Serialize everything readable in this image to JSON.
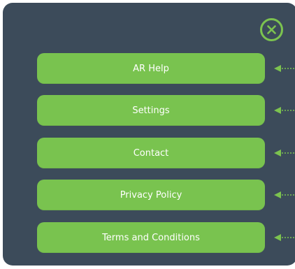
{
  "close": {
    "icon": "close-icon"
  },
  "menu": {
    "items": [
      {
        "label": "AR Help"
      },
      {
        "label": "Settings"
      },
      {
        "label": "Contact"
      },
      {
        "label": "Privacy Policy"
      },
      {
        "label": "Terms and Conditions"
      }
    ]
  },
  "colors": {
    "panel_bg": "#3c4b5a",
    "button_bg": "#79c34f",
    "button_text": "#ffffff",
    "accent": "#7cc34f"
  }
}
